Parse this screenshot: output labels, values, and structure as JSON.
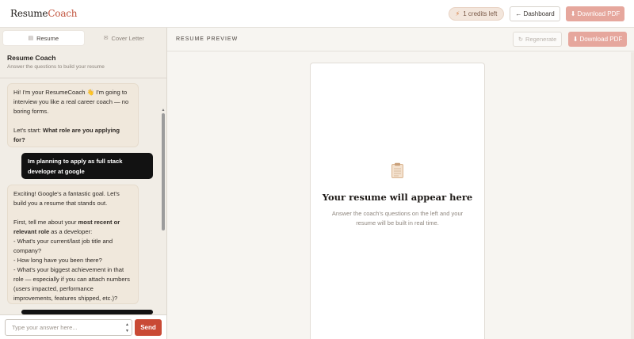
{
  "app": {
    "logo_part1": "Resume",
    "logo_part2": "Coach",
    "credits_label": "1 credits left",
    "dashboard_label": "← Dashboard",
    "download_pdf_label": "Download PDF",
    "accent_color": "#c94a35"
  },
  "left": {
    "tabs": [
      {
        "label": "Resume",
        "icon": "document-icon",
        "active": true
      },
      {
        "label": "Cover Letter",
        "icon": "envelope-icon",
        "active": false
      }
    ],
    "coach_title": "Resume Coach",
    "coach_subtitle": "Answer the questions to build your resume",
    "messages": {
      "m1_line1": "Hi! I'm your ResumeCoach 👋 I'm going to interview you like a real career coach — no boring forms.",
      "m1_start": "Let's start: ",
      "m1_q": "What role are you applying for?",
      "m2": "Im planning to apply as full stack developer at google",
      "m3_line1": "Exciting! Google's a fantastic goal. Let's build you a resume that stands out.",
      "m3_p2a": "First, tell me about your ",
      "m3_p2b": "most recent or relevant role",
      "m3_p2c": " as a developer:",
      "m3_b1": "- What's your current/last job title and company?",
      "m3_b2": "- How long have you been there?",
      "m3_b3": "- What's your biggest achievement in that role — especially if you can attach numbers (users impacted, performance improvements, features shipped, etc.)?"
    },
    "input_placeholder": "Type your answer here...",
    "send_label": "Send"
  },
  "preview": {
    "section_label": "RESUME PREVIEW",
    "regenerate_label": "Regenerate",
    "download_pdf_label": "Download PDF",
    "empty_title": "Your resume will appear here",
    "empty_subtitle": "Answer the coach's questions on the left and your resume will be built in real time."
  }
}
